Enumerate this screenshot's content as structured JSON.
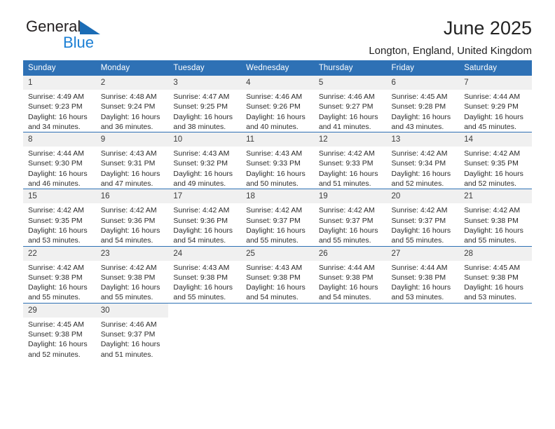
{
  "brand": {
    "name_part1": "General",
    "name_part2": "Blue",
    "triangle_icon": "blue-triangle-logo"
  },
  "header": {
    "title": "June 2025",
    "subtitle": "Longton, England, United Kingdom"
  },
  "colors": {
    "header_blue": "#2e71b5",
    "brand_blue": "#1b7fd4",
    "daynum_band": "#f0f0f0",
    "row_separator": "#2e71b5",
    "text": "#2b2b2b"
  },
  "weekdays": [
    "Sunday",
    "Monday",
    "Tuesday",
    "Wednesday",
    "Thursday",
    "Friday",
    "Saturday"
  ],
  "labels": {
    "sunrise_prefix": "Sunrise:",
    "sunset_prefix": "Sunset:",
    "daylight_prefix": "Daylight:"
  },
  "weeks": [
    [
      {
        "day": "1",
        "sunrise": "Sunrise: 4:49 AM",
        "sunset": "Sunset: 9:23 PM",
        "daylight_l1": "Daylight: 16 hours",
        "daylight_l2": "and 34 minutes."
      },
      {
        "day": "2",
        "sunrise": "Sunrise: 4:48 AM",
        "sunset": "Sunset: 9:24 PM",
        "daylight_l1": "Daylight: 16 hours",
        "daylight_l2": "and 36 minutes."
      },
      {
        "day": "3",
        "sunrise": "Sunrise: 4:47 AM",
        "sunset": "Sunset: 9:25 PM",
        "daylight_l1": "Daylight: 16 hours",
        "daylight_l2": "and 38 minutes."
      },
      {
        "day": "4",
        "sunrise": "Sunrise: 4:46 AM",
        "sunset": "Sunset: 9:26 PM",
        "daylight_l1": "Daylight: 16 hours",
        "daylight_l2": "and 40 minutes."
      },
      {
        "day": "5",
        "sunrise": "Sunrise: 4:46 AM",
        "sunset": "Sunset: 9:27 PM",
        "daylight_l1": "Daylight: 16 hours",
        "daylight_l2": "and 41 minutes."
      },
      {
        "day": "6",
        "sunrise": "Sunrise: 4:45 AM",
        "sunset": "Sunset: 9:28 PM",
        "daylight_l1": "Daylight: 16 hours",
        "daylight_l2": "and 43 minutes."
      },
      {
        "day": "7",
        "sunrise": "Sunrise: 4:44 AM",
        "sunset": "Sunset: 9:29 PM",
        "daylight_l1": "Daylight: 16 hours",
        "daylight_l2": "and 45 minutes."
      }
    ],
    [
      {
        "day": "8",
        "sunrise": "Sunrise: 4:44 AM",
        "sunset": "Sunset: 9:30 PM",
        "daylight_l1": "Daylight: 16 hours",
        "daylight_l2": "and 46 minutes."
      },
      {
        "day": "9",
        "sunrise": "Sunrise: 4:43 AM",
        "sunset": "Sunset: 9:31 PM",
        "daylight_l1": "Daylight: 16 hours",
        "daylight_l2": "and 47 minutes."
      },
      {
        "day": "10",
        "sunrise": "Sunrise: 4:43 AM",
        "sunset": "Sunset: 9:32 PM",
        "daylight_l1": "Daylight: 16 hours",
        "daylight_l2": "and 49 minutes."
      },
      {
        "day": "11",
        "sunrise": "Sunrise: 4:43 AM",
        "sunset": "Sunset: 9:33 PM",
        "daylight_l1": "Daylight: 16 hours",
        "daylight_l2": "and 50 minutes."
      },
      {
        "day": "12",
        "sunrise": "Sunrise: 4:42 AM",
        "sunset": "Sunset: 9:33 PM",
        "daylight_l1": "Daylight: 16 hours",
        "daylight_l2": "and 51 minutes."
      },
      {
        "day": "13",
        "sunrise": "Sunrise: 4:42 AM",
        "sunset": "Sunset: 9:34 PM",
        "daylight_l1": "Daylight: 16 hours",
        "daylight_l2": "and 52 minutes."
      },
      {
        "day": "14",
        "sunrise": "Sunrise: 4:42 AM",
        "sunset": "Sunset: 9:35 PM",
        "daylight_l1": "Daylight: 16 hours",
        "daylight_l2": "and 52 minutes."
      }
    ],
    [
      {
        "day": "15",
        "sunrise": "Sunrise: 4:42 AM",
        "sunset": "Sunset: 9:35 PM",
        "daylight_l1": "Daylight: 16 hours",
        "daylight_l2": "and 53 minutes."
      },
      {
        "day": "16",
        "sunrise": "Sunrise: 4:42 AM",
        "sunset": "Sunset: 9:36 PM",
        "daylight_l1": "Daylight: 16 hours",
        "daylight_l2": "and 54 minutes."
      },
      {
        "day": "17",
        "sunrise": "Sunrise: 4:42 AM",
        "sunset": "Sunset: 9:36 PM",
        "daylight_l1": "Daylight: 16 hours",
        "daylight_l2": "and 54 minutes."
      },
      {
        "day": "18",
        "sunrise": "Sunrise: 4:42 AM",
        "sunset": "Sunset: 9:37 PM",
        "daylight_l1": "Daylight: 16 hours",
        "daylight_l2": "and 55 minutes."
      },
      {
        "day": "19",
        "sunrise": "Sunrise: 4:42 AM",
        "sunset": "Sunset: 9:37 PM",
        "daylight_l1": "Daylight: 16 hours",
        "daylight_l2": "and 55 minutes."
      },
      {
        "day": "20",
        "sunrise": "Sunrise: 4:42 AM",
        "sunset": "Sunset: 9:37 PM",
        "daylight_l1": "Daylight: 16 hours",
        "daylight_l2": "and 55 minutes."
      },
      {
        "day": "21",
        "sunrise": "Sunrise: 4:42 AM",
        "sunset": "Sunset: 9:38 PM",
        "daylight_l1": "Daylight: 16 hours",
        "daylight_l2": "and 55 minutes."
      }
    ],
    [
      {
        "day": "22",
        "sunrise": "Sunrise: 4:42 AM",
        "sunset": "Sunset: 9:38 PM",
        "daylight_l1": "Daylight: 16 hours",
        "daylight_l2": "and 55 minutes."
      },
      {
        "day": "23",
        "sunrise": "Sunrise: 4:42 AM",
        "sunset": "Sunset: 9:38 PM",
        "daylight_l1": "Daylight: 16 hours",
        "daylight_l2": "and 55 minutes."
      },
      {
        "day": "24",
        "sunrise": "Sunrise: 4:43 AM",
        "sunset": "Sunset: 9:38 PM",
        "daylight_l1": "Daylight: 16 hours",
        "daylight_l2": "and 55 minutes."
      },
      {
        "day": "25",
        "sunrise": "Sunrise: 4:43 AM",
        "sunset": "Sunset: 9:38 PM",
        "daylight_l1": "Daylight: 16 hours",
        "daylight_l2": "and 54 minutes."
      },
      {
        "day": "26",
        "sunrise": "Sunrise: 4:44 AM",
        "sunset": "Sunset: 9:38 PM",
        "daylight_l1": "Daylight: 16 hours",
        "daylight_l2": "and 54 minutes."
      },
      {
        "day": "27",
        "sunrise": "Sunrise: 4:44 AM",
        "sunset": "Sunset: 9:38 PM",
        "daylight_l1": "Daylight: 16 hours",
        "daylight_l2": "and 53 minutes."
      },
      {
        "day": "28",
        "sunrise": "Sunrise: 4:45 AM",
        "sunset": "Sunset: 9:38 PM",
        "daylight_l1": "Daylight: 16 hours",
        "daylight_l2": "and 53 minutes."
      }
    ],
    [
      {
        "day": "29",
        "sunrise": "Sunrise: 4:45 AM",
        "sunset": "Sunset: 9:38 PM",
        "daylight_l1": "Daylight: 16 hours",
        "daylight_l2": "and 52 minutes."
      },
      {
        "day": "30",
        "sunrise": "Sunrise: 4:46 AM",
        "sunset": "Sunset: 9:37 PM",
        "daylight_l1": "Daylight: 16 hours",
        "daylight_l2": "and 51 minutes."
      },
      {
        "day": "",
        "sunrise": "",
        "sunset": "",
        "daylight_l1": "",
        "daylight_l2": ""
      },
      {
        "day": "",
        "sunrise": "",
        "sunset": "",
        "daylight_l1": "",
        "daylight_l2": ""
      },
      {
        "day": "",
        "sunrise": "",
        "sunset": "",
        "daylight_l1": "",
        "daylight_l2": ""
      },
      {
        "day": "",
        "sunrise": "",
        "sunset": "",
        "daylight_l1": "",
        "daylight_l2": ""
      },
      {
        "day": "",
        "sunrise": "",
        "sunset": "",
        "daylight_l1": "",
        "daylight_l2": ""
      }
    ]
  ]
}
